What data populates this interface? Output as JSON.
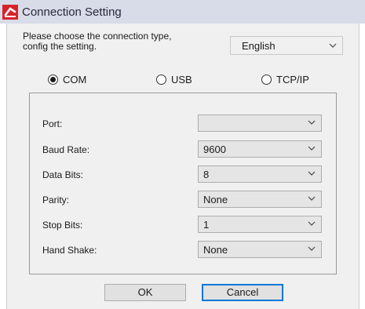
{
  "window": {
    "title": "Connection Setting",
    "icon": "app-logo-icon"
  },
  "prompt": {
    "line1": "Please choose the connection type,",
    "line2": "config the setting."
  },
  "language": {
    "selected": "English"
  },
  "connection_type": {
    "options": [
      {
        "label": "COM",
        "selected": true
      },
      {
        "label": "USB",
        "selected": false
      },
      {
        "label": "TCP/IP",
        "selected": false
      }
    ]
  },
  "fields": [
    {
      "label": "Port:",
      "value": ""
    },
    {
      "label": "Baud Rate:",
      "value": "9600"
    },
    {
      "label": "Data Bits:",
      "value": "8"
    },
    {
      "label": "Parity:",
      "value": "None"
    },
    {
      "label": "Stop Bits:",
      "value": "1"
    },
    {
      "label": "Hand Shake:",
      "value": "None"
    }
  ],
  "buttons": {
    "ok": "OK",
    "cancel": "Cancel"
  },
  "colors": {
    "titlebar": "#d8dbe8",
    "dialog_bg": "#f0f0f0",
    "focus_border": "#0078d7",
    "logo_red": "#d6232a"
  }
}
